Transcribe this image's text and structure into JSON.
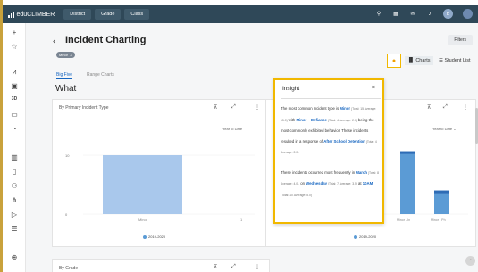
{
  "topbar": {
    "app_name": "eduCLIMBER",
    "tabs": [
      {
        "label": "District"
      },
      {
        "label": "Grade"
      },
      {
        "label": "Class"
      }
    ],
    "avatar_initials": "B"
  },
  "page": {
    "title": "Incident Charting",
    "filter_chip": "Minor",
    "filters_button": "Filters",
    "subtabs": [
      {
        "label": "Big Five",
        "active": true
      },
      {
        "label": "Range Charts"
      }
    ],
    "section_title": "What",
    "charts_button": "Charts",
    "student_list_button": "Student List"
  },
  "left_card": {
    "title": "By Primary Incident Type",
    "filter_label": "Year to Date",
    "chart_data": {
      "type": "bar",
      "categories": [
        "Minor"
      ],
      "series": [
        {
          "name": "2019-2020",
          "values": [
            15
          ]
        }
      ],
      "ylim": [
        0,
        20
      ],
      "yticks": [
        "10",
        "0"
      ],
      "xtick_right": "1"
    }
  },
  "right_card": {
    "filter_label": "Year to Date",
    "chart_data": {
      "type": "bar",
      "categories": [
        "Minor - De",
        "Minor - Di",
        "Minor - El",
        "Minor - In",
        "Minor - Ph"
      ],
      "series": [
        {
          "name": "2019-2020",
          "values": [
            0,
            0,
            0,
            8,
            3
          ]
        }
      ],
      "ylim": [
        0,
        10
      ],
      "yticks": [
        "0"
      ]
    }
  },
  "bottom_card": {
    "title": "By Grade"
  },
  "insight": {
    "title": "Insight",
    "close": "×",
    "p1_a": "The most common incident type is ",
    "p1_b": "Minor",
    "p1_c": " (Total: 15 Average: 15.0) ",
    "p1_d": "with ",
    "p1_e": "Minor – Defiance",
    "p1_f": " (Total: 4 Average: 2.0) ",
    "p1_g": "being the most commonly exhibited behavior. These incidents resulted in a response of ",
    "p1_h": "After School Detention",
    "p1_i": " (Total: 4 Average: 2.0).",
    "p2_a": "These incidents occurred most frequently in ",
    "p2_b": "March",
    "p2_c": " (Total: 8 Average: 4.0), ",
    "p2_d": "on ",
    "p2_e": "Wednesday",
    "p2_f": " (Total: 7 Average: 3.5) ",
    "p2_g": "at ",
    "p2_h": "10AM",
    "p2_i": " (Total: 10 Average: 5.0)"
  },
  "colors": {
    "topbar": "#2f4858",
    "bar": "#a9c8ec",
    "bar_dark": "#5b9bd5",
    "highlight": "#f1b800",
    "link": "#1565c0"
  }
}
